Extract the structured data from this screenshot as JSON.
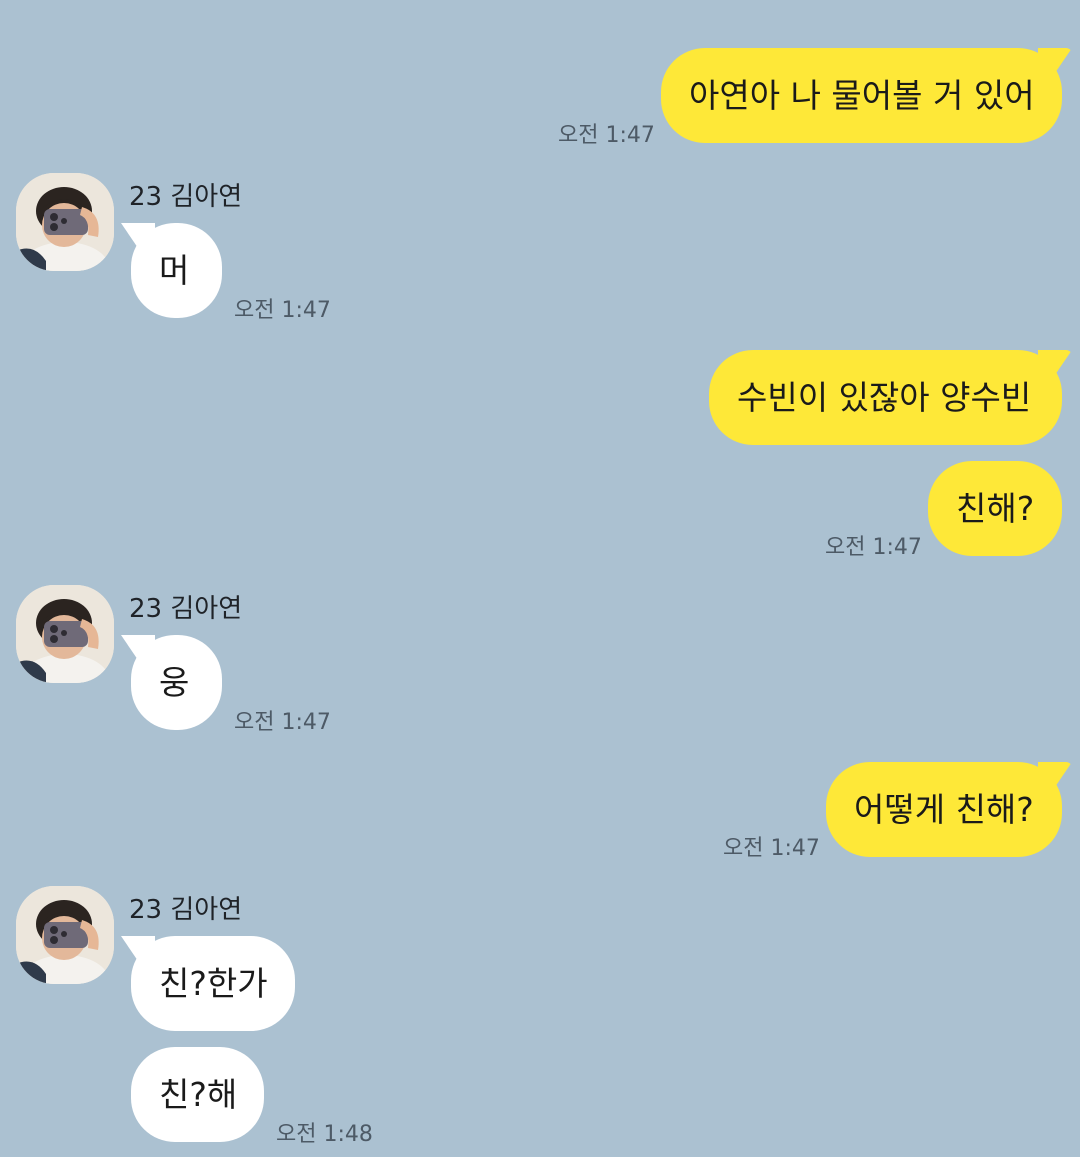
{
  "chat": {
    "messages": [
      {
        "id": "m1",
        "side": "me",
        "text": "아연아 나 물어볼 거 있어",
        "time": "오전 1:47"
      },
      {
        "id": "m2",
        "side": "other",
        "sender": "23 김아연",
        "text": "머",
        "time": "오전 1:47"
      },
      {
        "id": "m3",
        "side": "me",
        "text": "수빈이 있잖아 양수빈",
        "time": ""
      },
      {
        "id": "m4",
        "side": "me",
        "text": "친해?",
        "time": "오전 1:47"
      },
      {
        "id": "m5",
        "side": "other",
        "sender": "23 김아연",
        "text": "웅",
        "time": "오전 1:47"
      },
      {
        "id": "m6",
        "side": "me",
        "text": "어떻게 친해?",
        "time": "오전 1:47"
      },
      {
        "id": "m7",
        "side": "other",
        "sender": "23 김아연",
        "text": "친?한가",
        "time": ""
      },
      {
        "id": "m8",
        "side": "other",
        "text": "친?해",
        "time": "오전 1:48"
      }
    ]
  },
  "colors": {
    "background": "#abc1d1",
    "my_bubble": "#fee838",
    "their_bubble": "#ffffff",
    "time_text": "#4d5a66"
  },
  "icons": {
    "avatar": "profile-photo-avatar"
  }
}
